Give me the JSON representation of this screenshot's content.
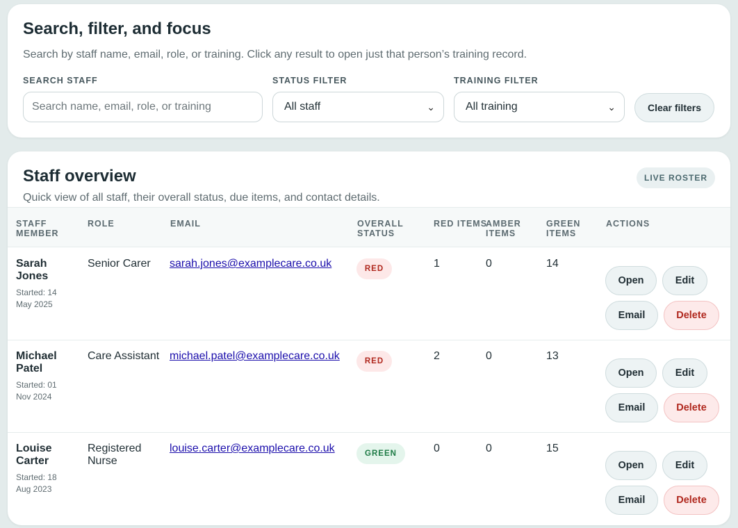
{
  "search_panel": {
    "title": "Search, filter, and focus",
    "description": "Search by staff name, email, role, or training. Click any result to open just that person’s training record.",
    "search_label": "SEARCH STAFF",
    "search_placeholder": "Search name, email, role, or training",
    "status_label": "STATUS FILTER",
    "status_value": "All staff",
    "training_label": "TRAINING FILTER",
    "training_value": "All training",
    "clear_label": "Clear filters",
    "chevron_glyph": "⌄"
  },
  "overview": {
    "title": "Staff overview",
    "description": "Quick view of all staff, their overall status, due items, and contact details.",
    "badge": "LIVE ROSTER",
    "headers": [
      "STAFF MEMBER",
      "ROLE",
      "EMAIL",
      "OVERALL STATUS",
      "RED ITEMS",
      "AMBER ITEMS",
      "GREEN ITEMS",
      "ACTIONS"
    ],
    "rows": [
      {
        "name": "Sarah Jones",
        "started": "Started: 14 May 2025",
        "role": "Senior Carer",
        "email": "sarah.jones@examplecare.co.uk",
        "status": "RED",
        "red": "1",
        "amber": "0",
        "green": "14"
      },
      {
        "name": "Michael Patel",
        "started": "Started: 01 Nov 2024",
        "role": "Care Assistant",
        "email": "michael.patel@examplecare.co.uk",
        "status": "RED",
        "red": "2",
        "amber": "0",
        "green": "13"
      },
      {
        "name": "Louise Carter",
        "started": "Started: 18 Aug 2023",
        "role": "Registered Nurse",
        "email": "louise.carter@examplecare.co.uk",
        "status": "GREEN",
        "red": "0",
        "amber": "0",
        "green": "15"
      }
    ],
    "actions": {
      "open": "Open",
      "edit": "Edit",
      "email": "Email",
      "delete": "Delete"
    }
  },
  "colors": {
    "background": "#e3ebeb",
    "status_red_bg": "#fde8e8",
    "status_red_text": "#b0281e",
    "status_green_bg": "#e4f5ec",
    "status_green_text": "#1d7a45",
    "link": "#1a0dab"
  }
}
